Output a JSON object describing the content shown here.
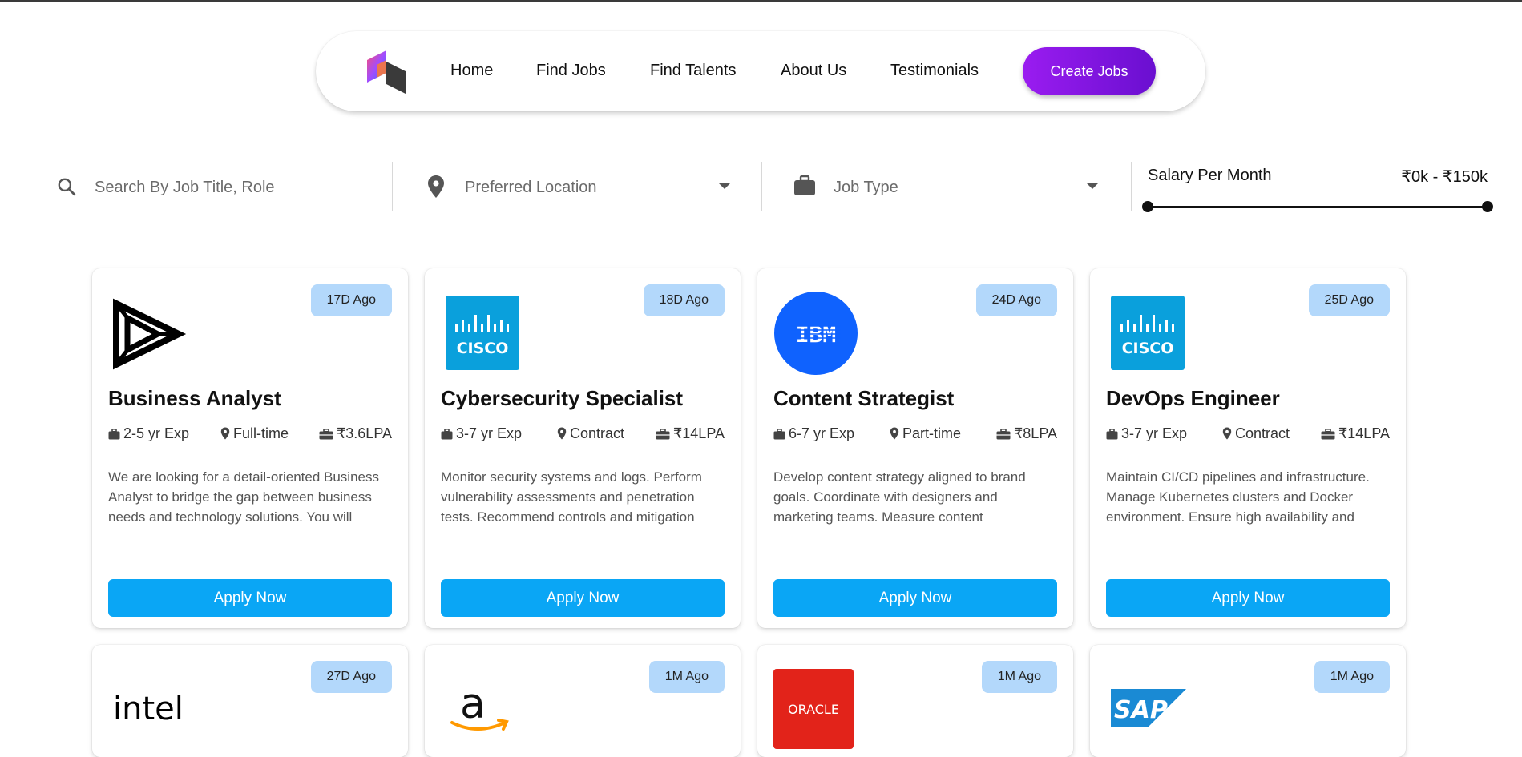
{
  "nav": {
    "links": [
      "Home",
      "Find Jobs",
      "Find Talents",
      "About Us",
      "Testimonials"
    ],
    "cta": "Create Jobs"
  },
  "filters": {
    "search_placeholder": "Search By Job Title, Role",
    "location_placeholder": "Preferred Location",
    "jobtype_placeholder": "Job Type",
    "salary_label": "Salary Per Month",
    "salary_range": "₹0k - ₹150k",
    "salary_min_fraction": 0.0,
    "salary_max_fraction": 1.0
  },
  "jobs": [
    {
      "company_logo": "triangle-logo",
      "posted": "17D Ago",
      "title": "Business Analyst",
      "experience": "2-5 yr Exp",
      "type": "Full-time",
      "salary": "₹3.6LPA",
      "description": "We are looking for a detail-oriented Business Analyst to bridge the gap between business needs and technology solutions. You will gather requirements, analyze data, and...",
      "apply": "Apply Now"
    },
    {
      "company_logo": "cisco-logo",
      "company_logo_text": "CISCO",
      "posted": "18D Ago",
      "title": "Cybersecurity Specialist",
      "experience": "3-7 yr Exp",
      "type": "Contract",
      "salary": "₹14LPA",
      "description": "Monitor security systems and logs. Perform vulnerability assessments and penetration tests. Recommend controls and mitigation strategies.",
      "apply": "Apply Now"
    },
    {
      "company_logo": "ibm-logo",
      "company_logo_text": "IBM",
      "posted": "24D Ago",
      "title": "Content Strategist",
      "experience": "6-7 yr Exp",
      "type": "Part-time",
      "salary": "₹8LPA",
      "description": "Develop content strategy aligned to brand goals. Coordinate with designers and marketing teams. Measure content effectiveness with analytics.",
      "apply": "Apply Now"
    },
    {
      "company_logo": "cisco-logo",
      "company_logo_text": "CISCO",
      "posted": "25D Ago",
      "title": "DevOps Engineer",
      "experience": "3-7 yr Exp",
      "type": "Contract",
      "salary": "₹14LPA",
      "description": "Maintain CI/CD pipelines and infrastructure. Manage Kubernetes clusters and Docker environment. Ensure high availability and monitoring setup.",
      "apply": "Apply Now"
    }
  ],
  "jobs_row2": [
    {
      "company_logo": "intel-logo",
      "company_logo_text": "intel",
      "posted": "27D Ago"
    },
    {
      "company_logo": "amazon-logo",
      "company_logo_text": "a",
      "posted": "1M Ago"
    },
    {
      "company_logo": "oracle-logo",
      "company_logo_text": "ORACLE",
      "posted": "1M Ago"
    },
    {
      "company_logo": "sap-logo",
      "company_logo_text": "SAP",
      "posted": "1M Ago"
    }
  ]
}
